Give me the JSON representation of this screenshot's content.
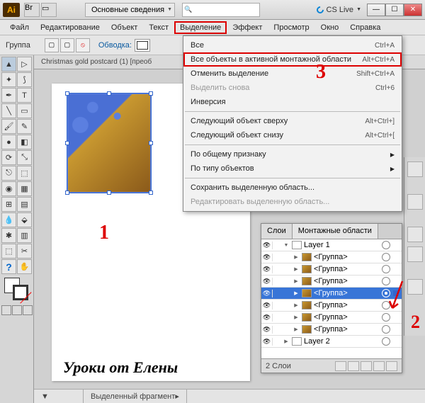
{
  "titlebar": {
    "logo": "Ai",
    "workspace": "Основные сведения",
    "cslive": "CS Live"
  },
  "menubar": {
    "items": [
      "Файл",
      "Редактирование",
      "Объект",
      "Текст",
      "Выделение",
      "Эффект",
      "Просмотр",
      "Окно",
      "Справка"
    ]
  },
  "controlbar": {
    "label": "Группа",
    "stroke": "Обводка:"
  },
  "document": {
    "tab": "Christmas gold postcard (1) [преоб"
  },
  "dropdown": {
    "items": [
      {
        "label": "Все",
        "shortcut": "Ctrl+A"
      },
      {
        "label": "Все объекты в активной монтажной области",
        "shortcut": "Alt+Ctrl+A",
        "boxed": true
      },
      {
        "label": "Отменить выделение",
        "shortcut": "Shift+Ctrl+A"
      },
      {
        "label": "Выделить снова",
        "shortcut": "Ctrl+6",
        "disabled": true
      },
      {
        "label": "Инверсия"
      },
      {
        "sep": true
      },
      {
        "label": "Следующий объект сверху",
        "shortcut": "Alt+Ctrl+]"
      },
      {
        "label": "Следующий объект снизу",
        "shortcut": "Alt+Ctrl+["
      },
      {
        "sep": true
      },
      {
        "label": "По общему признаку",
        "submenu": true
      },
      {
        "label": "По типу объектов",
        "submenu": true
      },
      {
        "sep": true
      },
      {
        "label": "Сохранить выделенную область..."
      },
      {
        "label": "Редактировать выделенную область...",
        "disabled": true
      }
    ]
  },
  "layers": {
    "tabs": [
      "Слои",
      "Монтажные области"
    ],
    "rows": [
      {
        "name": "Layer 1",
        "indent": 0,
        "expanded": true,
        "blank": true
      },
      {
        "name": "<Группа>",
        "indent": 1
      },
      {
        "name": "<Группа>",
        "indent": 1
      },
      {
        "name": "<Группа>",
        "indent": 1
      },
      {
        "name": "<Группа>",
        "indent": 1,
        "selected": true
      },
      {
        "name": "<Группа>",
        "indent": 1
      },
      {
        "name": "<Группа>",
        "indent": 1
      },
      {
        "name": "<Группа>",
        "indent": 1
      },
      {
        "name": "Layer 2",
        "indent": 0,
        "blank": true
      }
    ],
    "status": "2 Слои"
  },
  "annotations": {
    "n1": "1",
    "n2": "2",
    "n3": "3",
    "caption": "Уроки от Елены"
  },
  "statusbar": {
    "zoom": "",
    "tool": "Выделенный фрагмент"
  }
}
